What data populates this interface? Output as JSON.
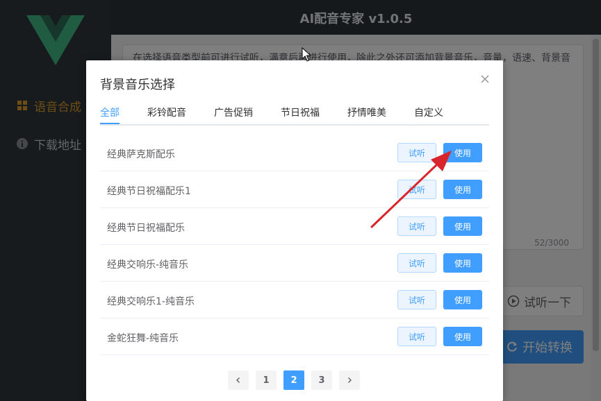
{
  "app": {
    "title": "AI配音专家 v1.0.5",
    "nav": [
      {
        "label": "语音合成",
        "icon": "grid-icon"
      },
      {
        "label": "下载地址",
        "icon": "info-icon"
      }
    ],
    "editor": {
      "text": "在选择语音类型前可进行试听，满意后再进行使用，除此之外还可添加背景音乐，音量，语速、背景音",
      "char_count": "52/3000"
    },
    "preview_label": "试听一下",
    "start_label": "开始转换"
  },
  "dialog": {
    "title": "背景音乐选择",
    "tabs": [
      "全部",
      "彩铃配音",
      "广告促销",
      "节日祝福",
      "抒情唯美",
      "自定义"
    ],
    "active_tab": 0,
    "try_label": "试听",
    "use_label": "使用",
    "items": [
      "经典萨克斯配乐",
      "经典节日祝福配乐1",
      "经典节日祝福配乐",
      "经典交响乐-纯音乐",
      "经典交响乐1-纯音乐",
      "金蛇狂舞-纯音乐"
    ],
    "pagination": {
      "pages": [
        "1",
        "2",
        "3"
      ],
      "current": "2"
    }
  },
  "colors": {
    "primary": "#409eff",
    "sidebar_active": "#d99b2b",
    "logo": "#41b883",
    "annotation_arrow": "#d9262c"
  }
}
